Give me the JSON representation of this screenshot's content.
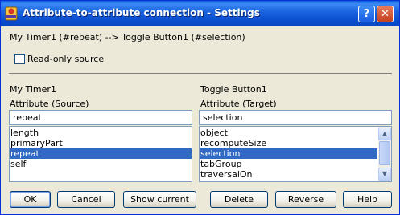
{
  "window": {
    "title": "Attribute-to-attribute connection - Settings",
    "help_glyph": "?",
    "close_glyph": "✕"
  },
  "connection_summary": "My Timer1 (#repeat) --> Toggle Button1 (#selection)",
  "readonly": {
    "label": "Read-only source",
    "checked": false
  },
  "source": {
    "object_name": "My Timer1",
    "attribute_label": "Attribute (Source)",
    "field_value": "repeat",
    "items": [
      "length",
      "primaryPart",
      "repeat",
      "self"
    ],
    "selected_index": 2
  },
  "target": {
    "object_name": "Toggle Button1",
    "attribute_label": "Attribute (Target)",
    "field_value": "selection",
    "items": [
      "object",
      "recomputeSize",
      "selection",
      "tabGroup",
      "traversalOn"
    ],
    "selected_index": 2
  },
  "buttons": {
    "ok": "OK",
    "cancel": "Cancel",
    "show_current": "Show current",
    "delete": "Delete",
    "reverse": "Reverse",
    "help": "Help"
  },
  "icons": {
    "app": "vast-app-icon",
    "help": "question-icon",
    "close": "close-icon",
    "scroll_up": "arrow-up-icon",
    "scroll_down": "arrow-down-icon"
  },
  "colors": {
    "titlebar": "#0a4fcf",
    "selection": "#316ac5",
    "dialog_bg": "#ece9d8"
  }
}
